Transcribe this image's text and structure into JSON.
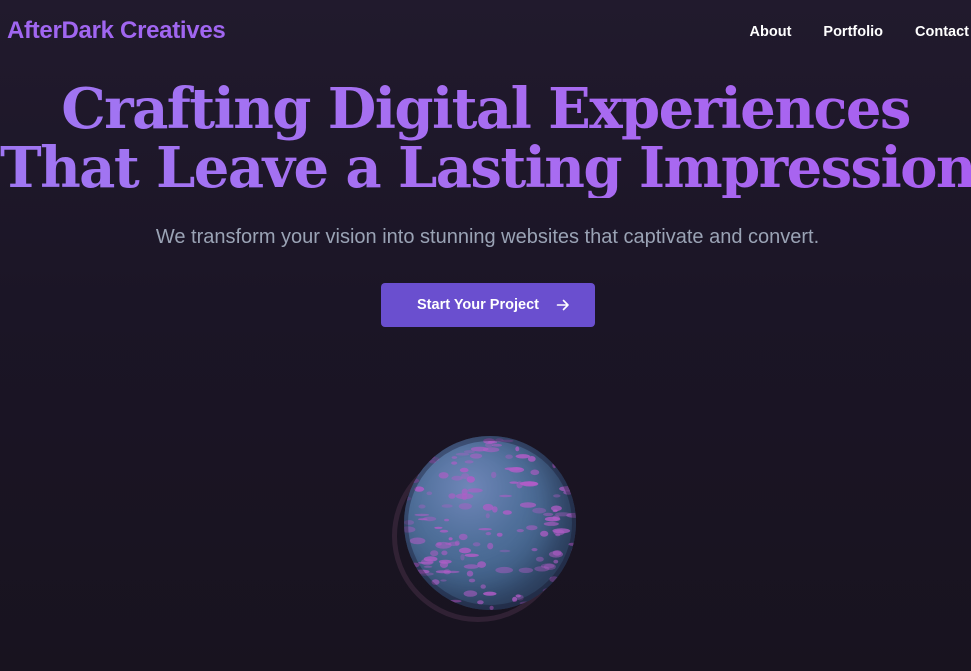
{
  "header": {
    "logo": "AfterDark Creatives",
    "nav": [
      {
        "label": "About"
      },
      {
        "label": "Portfolio"
      },
      {
        "label": "Contact"
      }
    ]
  },
  "hero": {
    "headline_line1": "Crafting Digital Experiences",
    "headline_line2": "That Leave a Lasting Impression",
    "subtitle": "We transform your vision into stunning websites that captivate and convert.",
    "cta_label": "Start Your Project",
    "cta_icon": "arrow-right-icon"
  },
  "planet": {
    "icon": "globe-illustration",
    "colors": {
      "base": "#4f6f9a",
      "spots": "#b25cc8"
    }
  },
  "colors": {
    "background": "#1b1526",
    "accent": "#a56ff2",
    "button": "#6a4fcf",
    "subtitle": "#9aa3b5"
  }
}
